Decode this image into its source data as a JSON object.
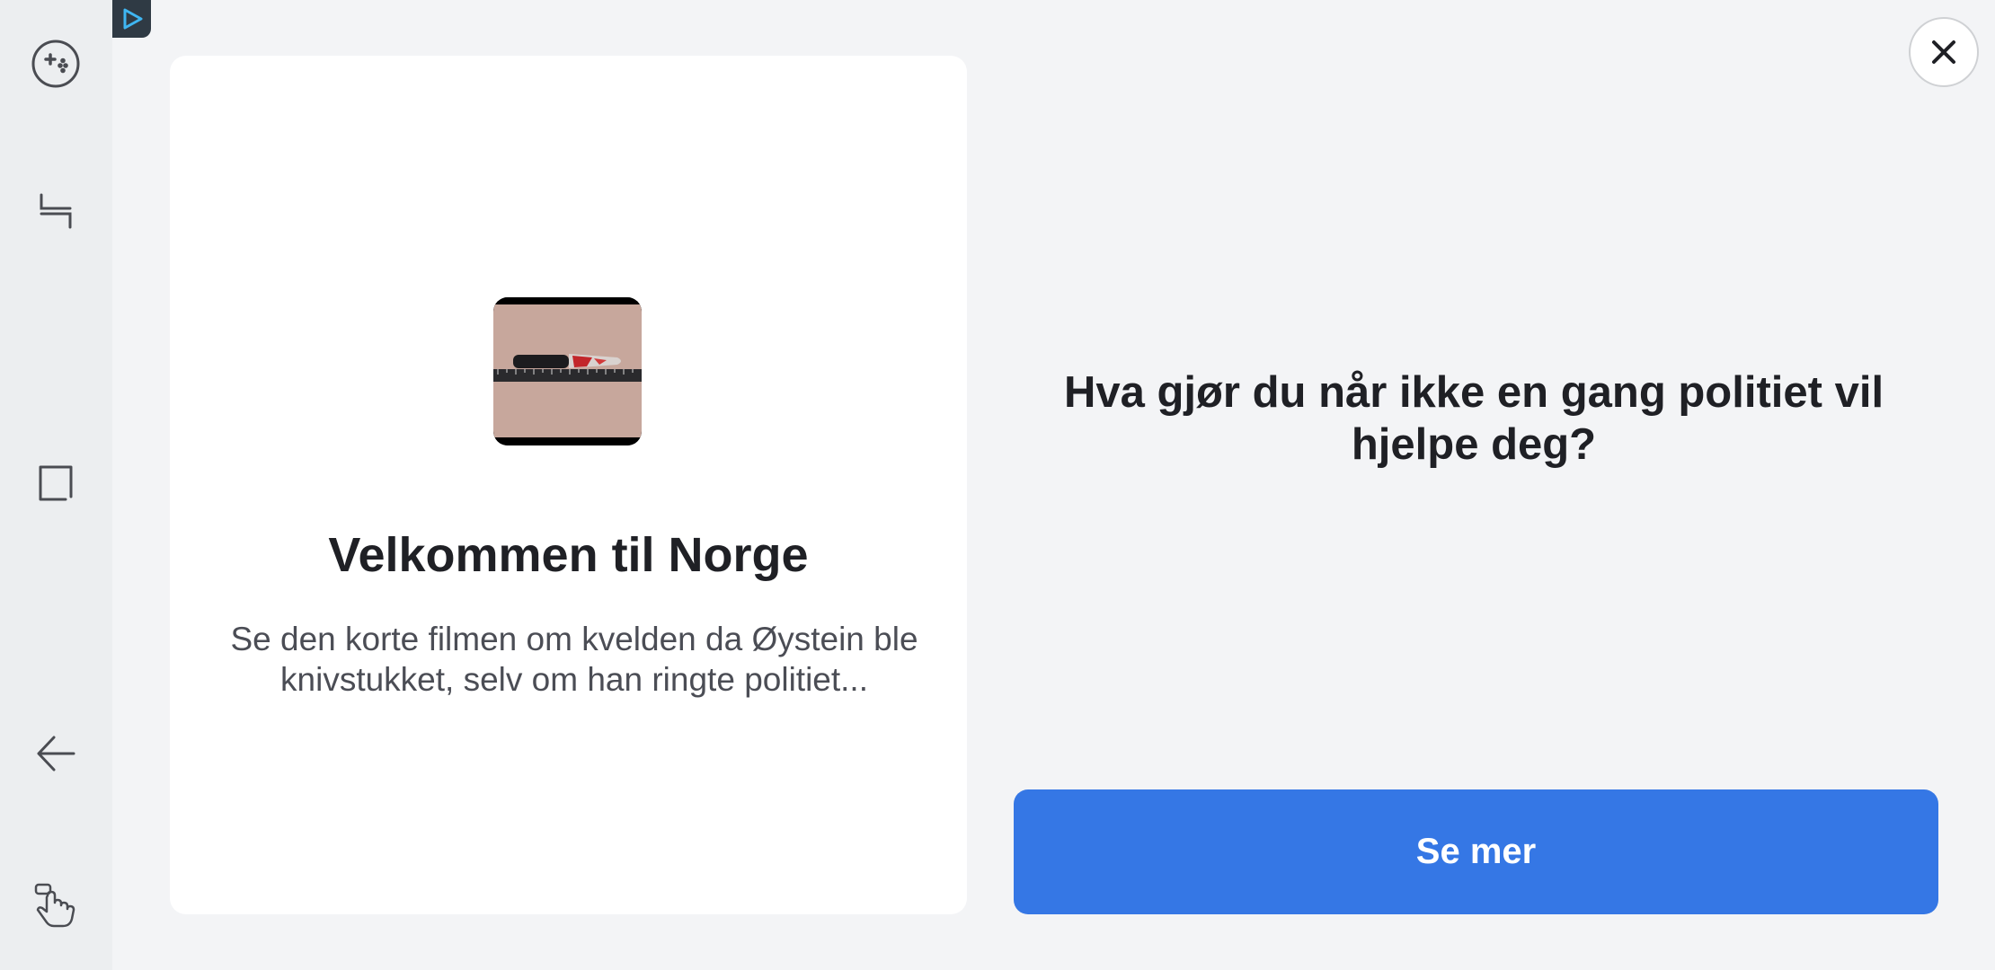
{
  "sidebar": {
    "items": [
      {
        "icon": "gamepad-icon"
      },
      {
        "icon": "split-view-icon"
      },
      {
        "icon": "square-icon"
      },
      {
        "icon": "back-arrow-icon"
      },
      {
        "icon": "gesture-hand-icon"
      }
    ]
  },
  "ad": {
    "badge_icon": "ad-play-badge-icon",
    "card": {
      "thumbnail_icon": "knife-thumbnail",
      "title": "Velkommen til Norge",
      "description": "Se den korte filmen om kvelden da Øystein ble knivstukket, selv om han ringte politiet..."
    },
    "headline": "Hva gjør du når ikke en gang politiet vil hjelpe deg?",
    "cta_label": "Se mer",
    "close_icon": "close-icon"
  },
  "colors": {
    "background": "#f3f4f6",
    "sidebar": "#eceef0",
    "card": "#ffffff",
    "cta": "#3577e5",
    "badge": "#2f3a44"
  }
}
